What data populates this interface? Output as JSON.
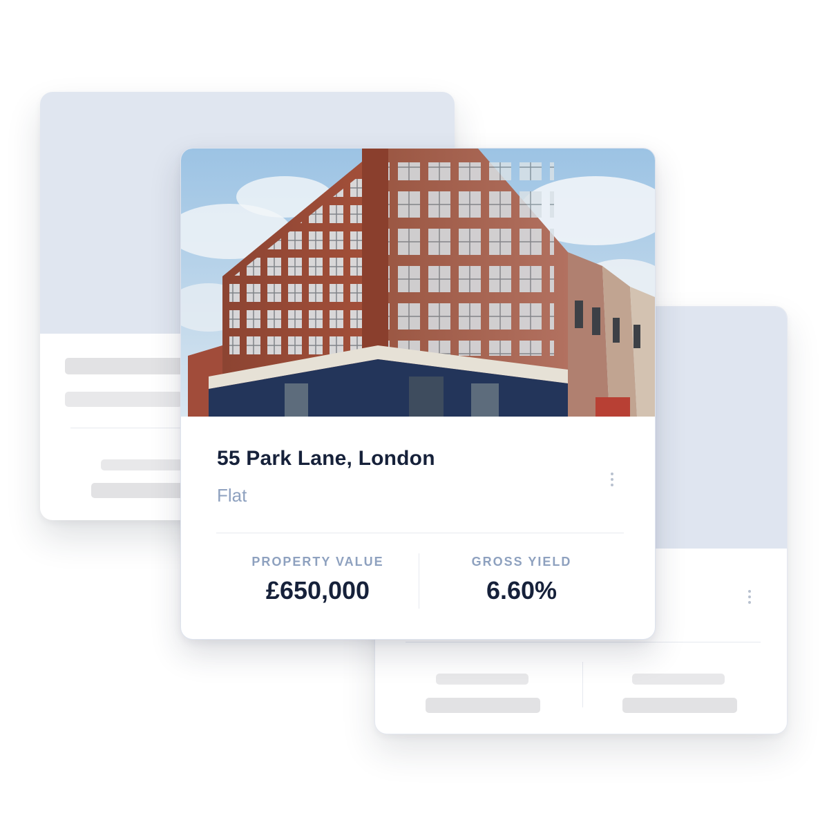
{
  "property": {
    "title": "55 Park Lane, London",
    "type": "Flat",
    "stats": [
      {
        "label": "PROPERTY VALUE",
        "value": "£650,000"
      },
      {
        "label": "GROSS YIELD",
        "value": "6.60%"
      }
    ]
  },
  "icons": {
    "menu": "kebab-menu-icon",
    "photo": "building-photo"
  },
  "colors": {
    "title": "#16213a",
    "muted": "#8ea1bf",
    "placeholder_image": "#e0e6f0",
    "placeholder_bar": "#e8e8ea",
    "brick": "#9b4530"
  }
}
